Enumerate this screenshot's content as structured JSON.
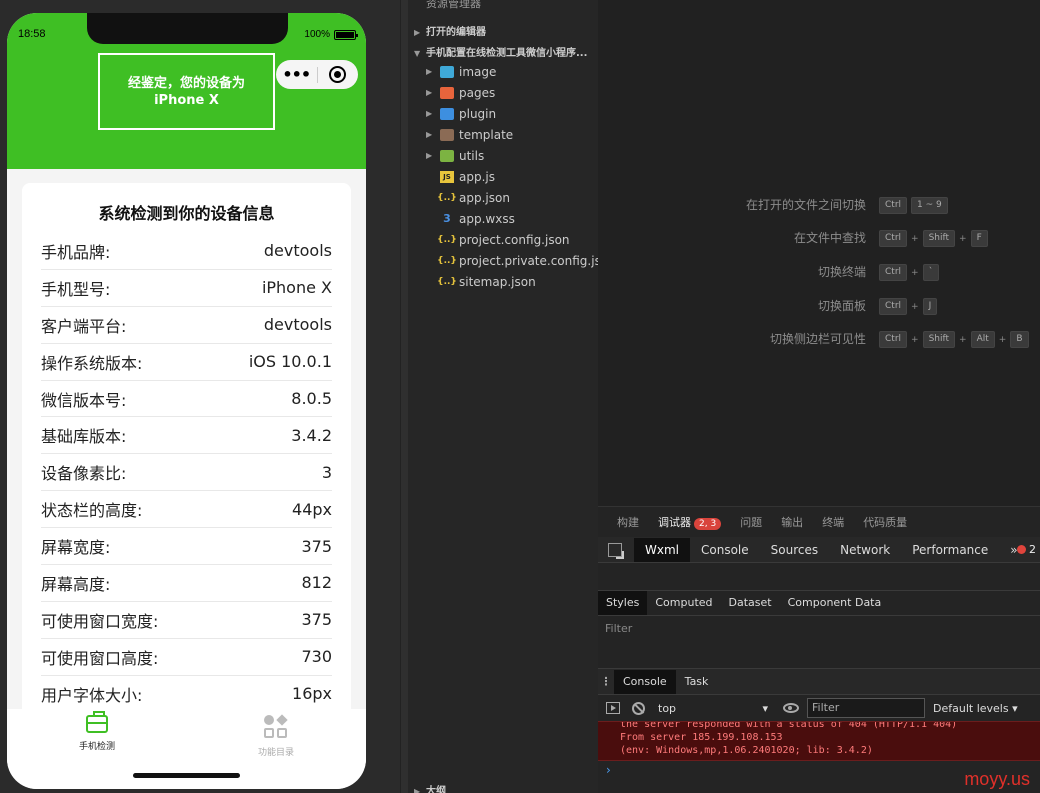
{
  "simulator": {
    "status_time": "18:58",
    "battery": "100%",
    "banner_line1": "经鉴定，您的设备为",
    "banner_line2": "iPhone X",
    "card_title": "系统检测到你的设备信息",
    "rows": [
      {
        "label": "手机品牌:",
        "value": "devtools"
      },
      {
        "label": "手机型号:",
        "value": "iPhone X"
      },
      {
        "label": "客户端平台:",
        "value": "devtools"
      },
      {
        "label": "操作系统版本:",
        "value": "iOS 10.0.1"
      },
      {
        "label": "微信版本号:",
        "value": "8.0.5"
      },
      {
        "label": "基础库版本:",
        "value": "3.4.2"
      },
      {
        "label": "设备像素比:",
        "value": "3"
      },
      {
        "label": "状态栏的高度:",
        "value": "44px"
      },
      {
        "label": "屏幕宽度:",
        "value": "375"
      },
      {
        "label": "屏幕高度:",
        "value": "812"
      },
      {
        "label": "可使用窗口宽度:",
        "value": "375"
      },
      {
        "label": "可使用窗口高度:",
        "value": "730"
      },
      {
        "label": "用户字体大小:",
        "value": "16px"
      }
    ],
    "tabs": [
      {
        "label": "手机检测",
        "icon": "toolbox-icon"
      },
      {
        "label": "功能目录",
        "icon": "grid-icon"
      }
    ]
  },
  "explorer": {
    "title": "资源管理器",
    "more": "···",
    "section_open": "打开的编辑器",
    "section_project": "手机配置在线检测工具微信小程序...",
    "section_outline": "大纲",
    "folders": [
      {
        "name": "image",
        "color": "#3fa9d8"
      },
      {
        "name": "pages",
        "color": "#e8643c"
      },
      {
        "name": "plugin",
        "color": "#3d8fe0"
      },
      {
        "name": "template",
        "color": "#8b6b55"
      },
      {
        "name": "utils",
        "color": "#7cb342"
      }
    ],
    "files": [
      {
        "name": "app.js",
        "glyph": "JS",
        "color": "#e8c53c"
      },
      {
        "name": "app.json",
        "glyph": "{..}",
        "color": "#e8c53c"
      },
      {
        "name": "app.wxss",
        "glyph": "3",
        "color": "#4a90e2"
      },
      {
        "name": "project.config.json",
        "glyph": "{..}",
        "color": "#e8c53c"
      },
      {
        "name": "project.private.config.js...",
        "glyph": "{..}",
        "color": "#e8c53c"
      },
      {
        "name": "sitemap.json",
        "glyph": "{..}",
        "color": "#e8c53c"
      }
    ]
  },
  "shortcuts": [
    {
      "label": "在打开的文件之间切换",
      "keys": [
        "Ctrl",
        "1 ~ 9"
      ]
    },
    {
      "label": "在文件中查找",
      "keys": [
        "Ctrl",
        "Shift",
        "F"
      ]
    },
    {
      "label": "切换终端",
      "keys": [
        "Ctrl",
        "`"
      ]
    },
    {
      "label": "切换面板",
      "keys": [
        "Ctrl",
        "J"
      ]
    },
    {
      "label": "切换侧边栏可见性",
      "keys": [
        "Ctrl",
        "Shift",
        "Alt",
        "B"
      ]
    }
  ],
  "panel": {
    "tabs": [
      "构建",
      "调试器",
      "问题",
      "输出",
      "终端",
      "代码质量"
    ],
    "debugger_badge": "2, 3",
    "devtools_tabs": [
      "Wxml",
      "Console",
      "Sources",
      "Network",
      "Performance"
    ],
    "overflow": "»",
    "error_count": "2",
    "style_tabs": [
      "Styles",
      "Computed",
      "Dataset",
      "Component Data"
    ],
    "filter_label": "Filter",
    "console_tabs": [
      "Console",
      "Task"
    ],
    "context": "top",
    "filter_placeholder": "Filter",
    "levels": "Default levels ▾",
    "error_lines": [
      "the server responded with a status of 404 (HTTP/1.1 404)",
      "From server 185.199.108.153",
      "(env: Windows,mp,1.06.2401020; lib: 3.4.2)"
    ],
    "prompt": "›"
  },
  "watermark": "moyy.us"
}
